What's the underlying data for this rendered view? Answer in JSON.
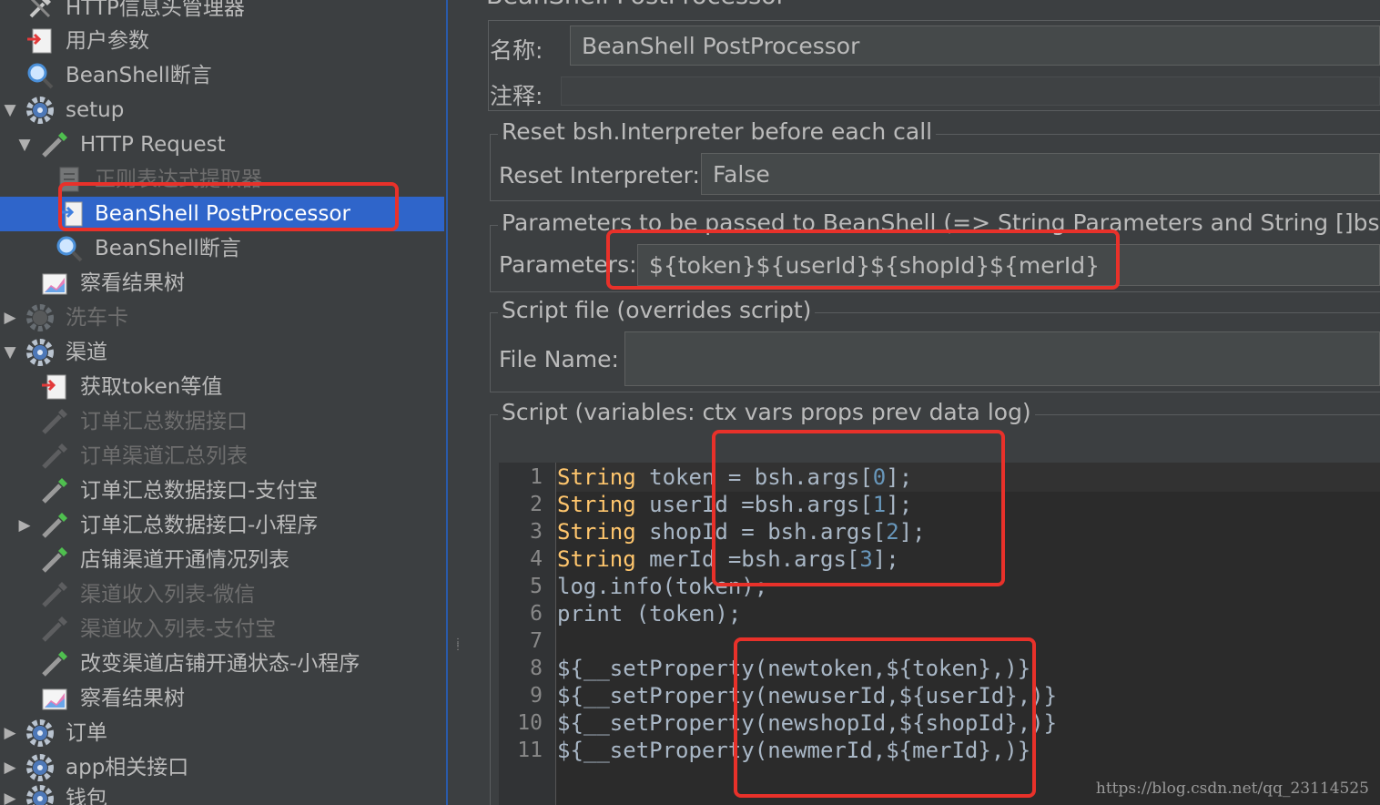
{
  "tree": {
    "nodes": [
      {
        "label": "HTTP信息头管理器",
        "icon": "wrench-icon",
        "toggle": ""
      },
      {
        "label": "用户参数",
        "icon": "preprocessor-icon",
        "toggle": ""
      },
      {
        "label": "BeanShell断言",
        "icon": "assertion-magnifier-icon",
        "toggle": ""
      },
      {
        "label": "setup",
        "icon": "gear-icon",
        "toggle": "▼"
      },
      {
        "label": "HTTP Request",
        "icon": "sampler-pipette-icon",
        "toggle": "▼"
      },
      {
        "label": "正则表达式提取器",
        "icon": "extractor-icon",
        "toggle": ""
      },
      {
        "label": "BeanShell PostProcessor",
        "icon": "postprocessor-icon",
        "toggle": ""
      },
      {
        "label": "BeanShell断言",
        "icon": "assertion-magnifier-icon",
        "toggle": ""
      },
      {
        "label": "察看结果树",
        "icon": "listener-chart-icon",
        "toggle": ""
      },
      {
        "label": "洗车卡",
        "icon": "gear-icon",
        "toggle": "▶"
      },
      {
        "label": "渠道",
        "icon": "gear-icon",
        "toggle": "▼"
      },
      {
        "label": "获取token等值",
        "icon": "preprocessor-icon",
        "toggle": ""
      },
      {
        "label": "订单汇总数据接口",
        "icon": "sampler-pipette-icon",
        "toggle": ""
      },
      {
        "label": "订单渠道汇总列表",
        "icon": "sampler-pipette-icon",
        "toggle": ""
      },
      {
        "label": "订单汇总数据接口-支付宝",
        "icon": "sampler-pipette-icon",
        "toggle": ""
      },
      {
        "label": "订单汇总数据接口-小程序",
        "icon": "sampler-pipette-icon",
        "toggle": "▶"
      },
      {
        "label": "店铺渠道开通情况列表",
        "icon": "sampler-pipette-icon",
        "toggle": ""
      },
      {
        "label": "渠道收入列表-微信",
        "icon": "sampler-pipette-icon",
        "toggle": ""
      },
      {
        "label": "渠道收入列表-支付宝",
        "icon": "sampler-pipette-icon",
        "toggle": ""
      },
      {
        "label": "改变渠道店铺开通状态-小程序",
        "icon": "sampler-pipette-icon",
        "toggle": ""
      },
      {
        "label": "察看结果树",
        "icon": "listener-chart-icon",
        "toggle": ""
      },
      {
        "label": "订单",
        "icon": "gear-icon",
        "toggle": "▶"
      },
      {
        "label": "app相关接口",
        "icon": "gear-icon",
        "toggle": "▶"
      },
      {
        "label": "钱包",
        "icon": "gear-icon",
        "toggle": "▶"
      }
    ]
  },
  "panel": {
    "title": "BeanShell PostProcessor",
    "name_label": "名称:",
    "name_value": "BeanShell PostProcessor",
    "comment_label": "注释:",
    "comment_value": "",
    "reset_group": "Reset bsh.Interpreter before each call",
    "reset_label": "Reset Interpreter:",
    "reset_value": "False",
    "params_group": "Parameters to be passed to BeanShell (=> String Parameters and String []bsh.",
    "params_label": "Parameters:",
    "params_value": "${token}${userId}${shopId}${merId}",
    "scriptfile_group": "Script file (overrides script)",
    "filename_label": "File Name:",
    "filename_value": "",
    "script_group": "Script (variables: ctx vars props prev data log)"
  },
  "script_lines": [
    {
      "n": "1",
      "kw": "String",
      "rest": " token = bsh.args[",
      "num": "0",
      "end": "];"
    },
    {
      "n": "2",
      "kw": "String",
      "rest": " userId =bsh.args[",
      "num": "1",
      "end": "];"
    },
    {
      "n": "3",
      "kw": "String",
      "rest": " shopId = bsh.args[",
      "num": "2",
      "end": "];"
    },
    {
      "n": "4",
      "kw": "String",
      "rest": " merId =bsh.args[",
      "num": "3",
      "end": "];"
    },
    {
      "n": "5",
      "kw": "",
      "rest": "log.info(token);",
      "num": "",
      "end": ""
    },
    {
      "n": "6",
      "kw": "",
      "rest": "print (token);",
      "num": "",
      "end": ""
    },
    {
      "n": "7",
      "kw": "",
      "rest": "",
      "num": "",
      "end": ""
    },
    {
      "n": "8",
      "kw": "",
      "rest": "${__setProperty(newtoken,${token},)}",
      "num": "",
      "end": ""
    },
    {
      "n": "9",
      "kw": "",
      "rest": "${__setProperty(newuserId,${userId},)}",
      "num": "",
      "end": ""
    },
    {
      "n": "10",
      "kw": "",
      "rest": "${__setProperty(newshopId,${shopId},)}",
      "num": "",
      "end": ""
    },
    {
      "n": "11",
      "kw": "",
      "rest": "${__setProperty(newmerId,${merId},)}",
      "num": "",
      "end": ""
    }
  ],
  "watermark": "https://blog.csdn.net/qq_23114525",
  "colors": {
    "selection": "#2f65ca",
    "annotation": "#e8312a",
    "keyword": "#ffc66d",
    "number": "#6897bb"
  }
}
